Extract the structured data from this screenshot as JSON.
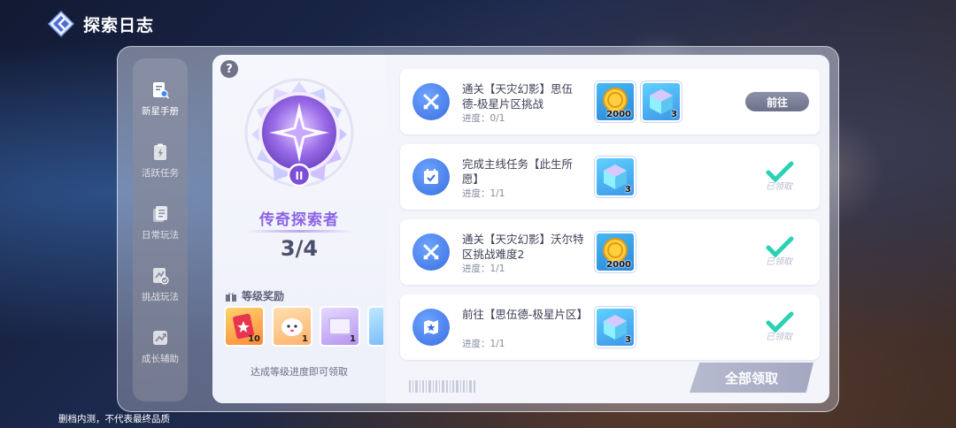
{
  "header": {
    "title": "探索日志",
    "logo_icon": "back-arrow-logo-icon"
  },
  "sidebar": {
    "items": [
      {
        "label": "新星手册",
        "icon": "notebook-icon",
        "active": true
      },
      {
        "label": "活跃任务",
        "icon": "clipboard-lightning-icon",
        "active": false
      },
      {
        "label": "日常玩法",
        "icon": "document-stack-icon",
        "active": false
      },
      {
        "label": "挑战玩法",
        "icon": "challenge-badge-icon",
        "active": false
      },
      {
        "label": "成长辅助",
        "icon": "growth-chart-icon",
        "active": false
      }
    ]
  },
  "rank": {
    "title": "传奇探索者",
    "progress": "3/4",
    "medal_level": "II"
  },
  "level_rewards": {
    "label": "等级奖励",
    "items": [
      {
        "icon": "red-card-item-icon",
        "qty": "10"
      },
      {
        "icon": "cloud-pet-item-icon",
        "qty": "1"
      },
      {
        "icon": "frame-item-icon",
        "qty": "1"
      }
    ],
    "hint": "达成等级进度即可领取"
  },
  "tasks": [
    {
      "title": "通关【天灾幻影】思伍德-极星片区挑战",
      "progress": "进度：0/1",
      "icon": "crossed-swords-icon",
      "rewards": [
        {
          "type": "coin",
          "qty": "2000"
        },
        {
          "type": "cube",
          "qty": "3"
        }
      ],
      "status": "goto",
      "button_label": "前往"
    },
    {
      "title": "完成主线任务【此生所愿】",
      "progress": "进度：1/1",
      "icon": "calendar-check-icon",
      "rewards": [
        {
          "type": "cube",
          "qty": "3"
        }
      ],
      "status": "claimed",
      "claimed_label": "已领取"
    },
    {
      "title": "通关【天灾幻影】沃尔特区挑战难度2",
      "progress": "进度：1/1",
      "icon": "crossed-swords-icon",
      "rewards": [
        {
          "type": "coin",
          "qty": "2000"
        }
      ],
      "status": "claimed",
      "claimed_label": "已领取"
    },
    {
      "title": "前往【思伍德-极星片区】",
      "progress": "进度：1/1",
      "icon": "map-star-icon",
      "rewards": [
        {
          "type": "cube",
          "qty": "3"
        }
      ],
      "status": "claimed",
      "claimed_label": "已领取"
    }
  ],
  "claim_all_label": "全部领取",
  "footer_note": "删档内测，不代表最终品质",
  "colors": {
    "accent_purple": "#8b63e6",
    "task_icon_blue": "#3a6fe0",
    "claimed_teal": "#2bd1b4"
  }
}
